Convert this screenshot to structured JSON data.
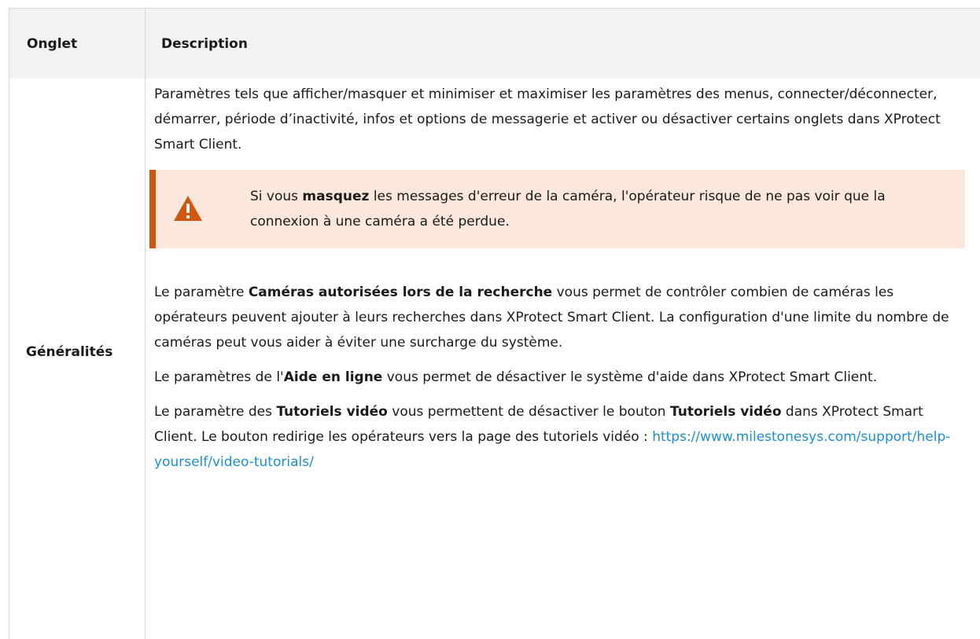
{
  "table": {
    "headers": [
      "Onglet",
      "Description"
    ],
    "row_label": "Généralités"
  },
  "content": {
    "intro": "Paramètres tels que afficher/masquer et minimiser et maximiser les paramètres des menus, connecter/déconnecter, démarrer, période d’inactivité, infos et options de messagerie et activer ou désactiver certains onglets dans XProtect Smart Client.",
    "warning": {
      "before": "Si vous ",
      "bold": "masquez",
      "after": " les messages d'erreur de la caméra, l'opérateur risque de ne pas voir que la connexion à une caméra a été perdue."
    },
    "para_cameras": {
      "before": "Le paramètre ",
      "bold": "Caméras autorisées lors de la recherche",
      "after": " vous permet de contrôler combien de caméras les opérateurs peuvent ajouter à leurs recherches dans XProtect Smart Client. La configuration d'une limite du nombre de caméras peut vous aider à éviter une surcharge du système."
    },
    "para_help": {
      "before": "Le paramètres de l'",
      "bold": "Aide en ligne",
      "after": " vous permet de désactiver le système d'aide dans XProtect Smart Client."
    },
    "para_video": {
      "before": "Le paramètre des ",
      "bold1": "Tutoriels vidéo",
      "middle": " vous permettent de désactiver le bouton ",
      "bold2": "Tutoriels vidéo",
      "after": " dans XProtect Smart Client. Le bouton redirige les opérateurs vers la page des tutoriels vidéo : ",
      "link": "https://www.milestonesys.com/support/help-yourself/video-tutorials/"
    }
  },
  "colors": {
    "header_bg": "#f2f2f2",
    "border": "#d7d7d7",
    "warning_bg": "#fbe7dc",
    "warning_accent": "#d2560d",
    "link": "#1a8fd6"
  }
}
